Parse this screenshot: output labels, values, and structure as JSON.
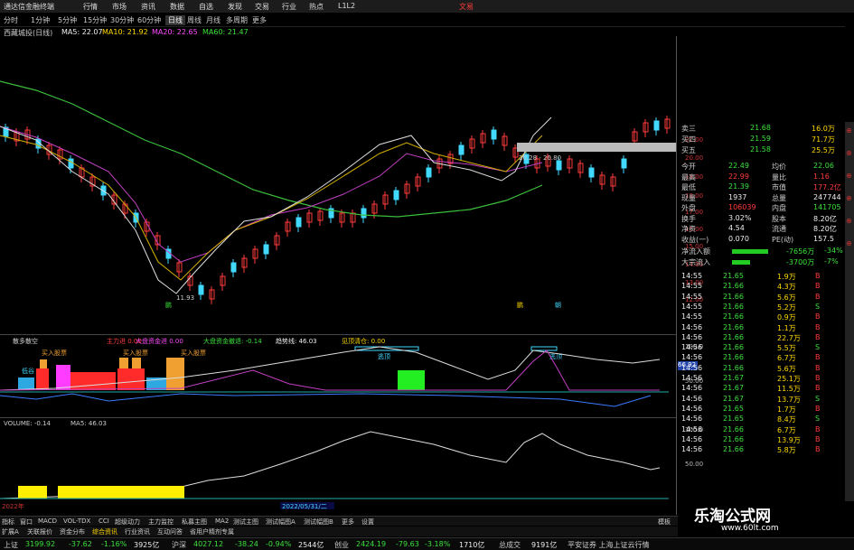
{
  "app": {
    "title": "通达信金融终端",
    "right": "文易"
  },
  "periods": [
    "分时",
    "1分钟",
    "5分钟",
    "15分钟",
    "30分钟",
    "60分钟",
    "日线",
    "周线",
    "月线",
    "多周期",
    "更多"
  ],
  "menus": [
    "行情",
    "市场",
    "资讯",
    "数据",
    "自选",
    "发现",
    "交易",
    "行业",
    "热点",
    "L1L2"
  ],
  "stock": {
    "name": "西藏城投(日线)",
    "ma5": "MA5: 22.07",
    "ma10": "MA10: 21.92",
    "ma20": "MA20: 22.65",
    "ma60": "MA60: 21.47"
  },
  "main_chart": {
    "low_label": "11.93",
    "range_label": "20.28 - 20.80",
    "scale": [
      "21.00",
      "20.00",
      "19.00",
      "18.00",
      "17.00",
      "16.00",
      "15.00",
      "14.00",
      "13.00",
      "12.00"
    ],
    "markers": [
      "鹏",
      "鹏",
      "朝"
    ]
  },
  "indicator1": {
    "name": "散多散空",
    "main_force_in": "主力进 0.00",
    "big_force": "大盘资金进 0.00",
    "big_money": "大盘资金撤退: -0.14",
    "trend": "趋势线: 46.03",
    "bottom_fish": "见顶清仓: 0.00",
    "buy_labels": [
      "买入股票",
      "买入股票",
      "买入股票"
    ],
    "pressure": [
      "逃顶",
      "逃顶"
    ],
    "low_tag": "低谷",
    "right_value": "66.92",
    "scale": [
      "100.0",
      "50.00"
    ]
  },
  "indicator2": {
    "label": "VOLUME: -0.14",
    "ma5": "MA5: 46.03",
    "scale": [
      "100.0",
      "50.00"
    ],
    "date_tag": "2022/05/31/二",
    "year": "2022年"
  },
  "quote": {
    "rows": [
      {
        "k": "卖三",
        "v": "21.68",
        "n": "16.0万"
      },
      {
        "k": "买四",
        "v": "21.59",
        "n": "71.7万"
      },
      {
        "k": "买五",
        "v": "21.58",
        "n": "25.5万"
      }
    ],
    "stats": [
      {
        "a": "今开",
        "b": "22.49",
        "c": "均价",
        "d": "22.06"
      },
      {
        "a": "最高",
        "b": "22.99",
        "c": "量比",
        "d": "1.16"
      },
      {
        "a": "最低",
        "b": "21.39",
        "c": "市值",
        "d": "177.2亿"
      },
      {
        "a": "现量",
        "b": "1937",
        "c": "总量",
        "d": "247744"
      },
      {
        "a": "外盘",
        "b": "106039",
        "c": "内盘",
        "d": "141705"
      },
      {
        "a": "换手",
        "b": "3.02%",
        "c": "股本",
        "d": "8.20亿"
      },
      {
        "a": "净资",
        "b": "4.54",
        "c": "流通",
        "d": "8.20亿"
      },
      {
        "a": "收益(一)",
        "b": "0.070",
        "c": "PE(动)",
        "d": "157.5"
      }
    ],
    "flow": [
      {
        "k": "净流入额",
        "v": "-7656万",
        "p": "-34%"
      },
      {
        "k": "大宗流入",
        "v": "-3700万",
        "p": "-7%"
      }
    ],
    "ticks": [
      {
        "t": "14:55",
        "p": "21.65",
        "v": "1.9万",
        "s": "B"
      },
      {
        "t": "14:55",
        "p": "21.66",
        "v": "4.3万",
        "s": "B"
      },
      {
        "t": "14:55",
        "p": "21.66",
        "v": "5.6万",
        "s": "B"
      },
      {
        "t": "14:55",
        "p": "21.66",
        "v": "5.2万",
        "s": "S"
      },
      {
        "t": "14:55",
        "p": "21.66",
        "v": "0.9万",
        "s": "B"
      },
      {
        "t": "14:56",
        "p": "21.66",
        "v": "1.1万",
        "s": "B"
      },
      {
        "t": "14:56",
        "p": "21.66",
        "v": "22.7万",
        "s": "B"
      },
      {
        "t": "14:56",
        "p": "21.66",
        "v": "5.5万",
        "s": "S"
      },
      {
        "t": "14:56",
        "p": "21.66",
        "v": "6.7万",
        "s": "B"
      },
      {
        "t": "14:56",
        "p": "21.66",
        "v": "5.6万",
        "s": "B"
      },
      {
        "t": "14:56",
        "p": "21.67",
        "v": "25.1万",
        "s": "B"
      },
      {
        "t": "14:56",
        "p": "21.67",
        "v": "11.5万",
        "s": "B"
      },
      {
        "t": "14:56",
        "p": "21.67",
        "v": "13.7万",
        "s": "S"
      },
      {
        "t": "14:56",
        "p": "21.65",
        "v": "1.7万",
        "s": "B"
      },
      {
        "t": "14:56",
        "p": "21.65",
        "v": "8.4万",
        "s": "S"
      },
      {
        "t": "14:56",
        "p": "21.66",
        "v": "6.7万",
        "s": "B"
      },
      {
        "t": "14:56",
        "p": "21.66",
        "v": "13.9万",
        "s": "B"
      },
      {
        "t": "14:56",
        "p": "21.66",
        "v": "5.8万",
        "s": "B"
      }
    ]
  },
  "bottom_tabs": [
    "指标",
    "窗口",
    "MACD",
    "VOL-TDX",
    "CCI",
    "超级动力",
    "主力监控",
    "私募主图",
    "MA2",
    "测试主图",
    "测试幅图A",
    "测试幅图B",
    "更多",
    "设置"
  ],
  "bottom_right": "模板",
  "status": {
    "sh_label": "上证",
    "sh": "3199.92",
    "sh_ch": "-37.62",
    "sh_pct": "-1.16%",
    "sh_amt": "3925亿",
    "sz_label": "沪深",
    "sz": "4027.12",
    "sz_ch": "-38.24",
    "sz_pct": "-0.94%",
    "sz_amt": "2544亿",
    "cy_label": "创业",
    "cy": "2424.19",
    "cy_ch": "-79.63",
    "cy_pct": "-3.18%",
    "cy_amt": "1710亿",
    "total_label": "总成交",
    "total": "9191亿",
    "broker": "平安证券 上海上证云行情"
  },
  "status_tabs": [
    "扩展A",
    "关联报价",
    "资金分布",
    "综合资讯",
    "行业资讯",
    "互动问答",
    "省用户精剂专属"
  ],
  "watermark": {
    "line1": "乐淘公式网",
    "line2": "www.60lt.com"
  }
}
